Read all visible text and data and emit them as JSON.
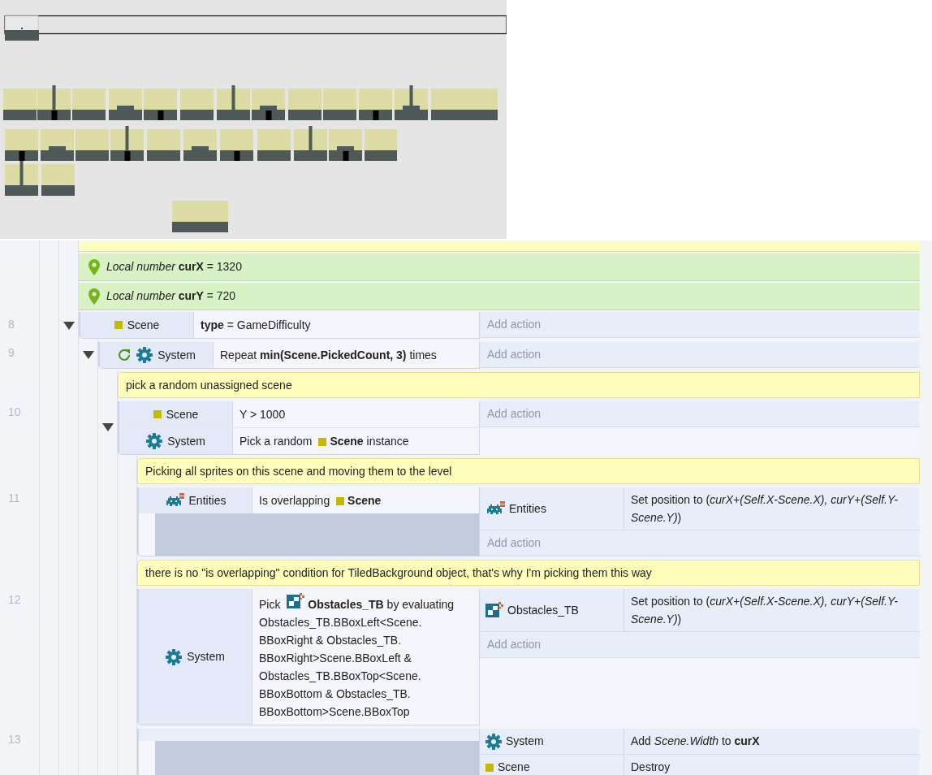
{
  "sheet": [
    {
      "kind": "comment"
    },
    {
      "kind": "variable",
      "text": "*Local number* **curX** = 1320"
    },
    {
      "kind": "variable",
      "text": "*Local number* **curY** = 720"
    },
    {
      "kind": "event",
      "number": "8",
      "expanded": true,
      "conditions": [
        {
          "object": "Scene",
          "kind": "sprite",
          "text": "**type** = GameDifficulty"
        }
      ],
      "add_action": "Add action",
      "children": [
        {
          "kind": "event",
          "number": "9",
          "expanded": true,
          "loop": true,
          "conditions": [
            {
              "object": "System",
              "kind": "system",
              "text": "Repeat **min(Scene.PickedCount, 3)** times"
            }
          ],
          "add_action": "Add action",
          "children": [
            {
              "kind": "comment",
              "text": "pick a random unassigned scene"
            },
            {
              "kind": "event",
              "number": "10",
              "expanded": true,
              "conditions": [
                {
                  "object": "Scene",
                  "kind": "sprite",
                  "text": "Y > 1000"
                },
                {
                  "object": "System",
                  "kind": "system",
                  "text": "Pick a random",
                  "ref": {
                    "object": "Scene",
                    "kind": "sprite"
                  },
                  "after": "instance"
                }
              ],
              "add_action": "Add action",
              "children": [
                {
                  "kind": "comment",
                  "text": "Picking all sprites on this scene and moving them to the level"
                },
                {
                  "kind": "event",
                  "number": "11",
                  "expanded": false,
                  "conditions": [
                    {
                      "object": "Entities",
                      "kind": "family",
                      "text": "Is overlapping",
                      "ref": {
                        "object": "Scene",
                        "kind": "sprite"
                      }
                    }
                  ],
                  "actions": [
                    {
                      "object": "Entities",
                      "kind": "family",
                      "text": "Set position to (*curX+(Self.X-Scene.X), curY+(Self.Y-Scene.Y)*)"
                    }
                  ],
                  "add_action": "Add action"
                },
                {
                  "kind": "comment",
                  "text": "there is no \"is overlapping\" condition for TiledBackground object, that's why I'm picking them this way"
                },
                {
                  "kind": "event",
                  "number": "12",
                  "expanded": false,
                  "conditions": [
                    {
                      "object": "System",
                      "kind": "system",
                      "text": "Pick",
                      "ref": {
                        "object": "Obstacles_TB",
                        "kind": "tiled"
                      },
                      "after": "by evaluating\nObstacles_TB.BBoxLeft<Scene.\nBBoxRight & Obstacles_TB.\nBBoxRight>Scene.BBoxLeft &\nObstacles_TB.BBoxTop<Scene.\nBBoxBottom & Obstacles_TB.\nBBoxBottom>Scene.BBoxTop"
                    }
                  ],
                  "actions": [
                    {
                      "object": "Obstacles_TB",
                      "kind": "tiled",
                      "text": "Set position to (*curX+(Self.X-Scene.X), curY+(Self.Y-Scene.Y)*)"
                    }
                  ],
                  "add_action": "Add action"
                },
                {
                  "kind": "event",
                  "number": "13",
                  "expanded": false,
                  "actions": [
                    {
                      "object": "System",
                      "kind": "system",
                      "text": "Add *Scene.Width* to **curX**"
                    },
                    {
                      "object": "Scene",
                      "kind": "sprite",
                      "text": "Destroy"
                    }
                  ]
                }
              ]
            }
          ]
        }
      ]
    }
  ]
}
